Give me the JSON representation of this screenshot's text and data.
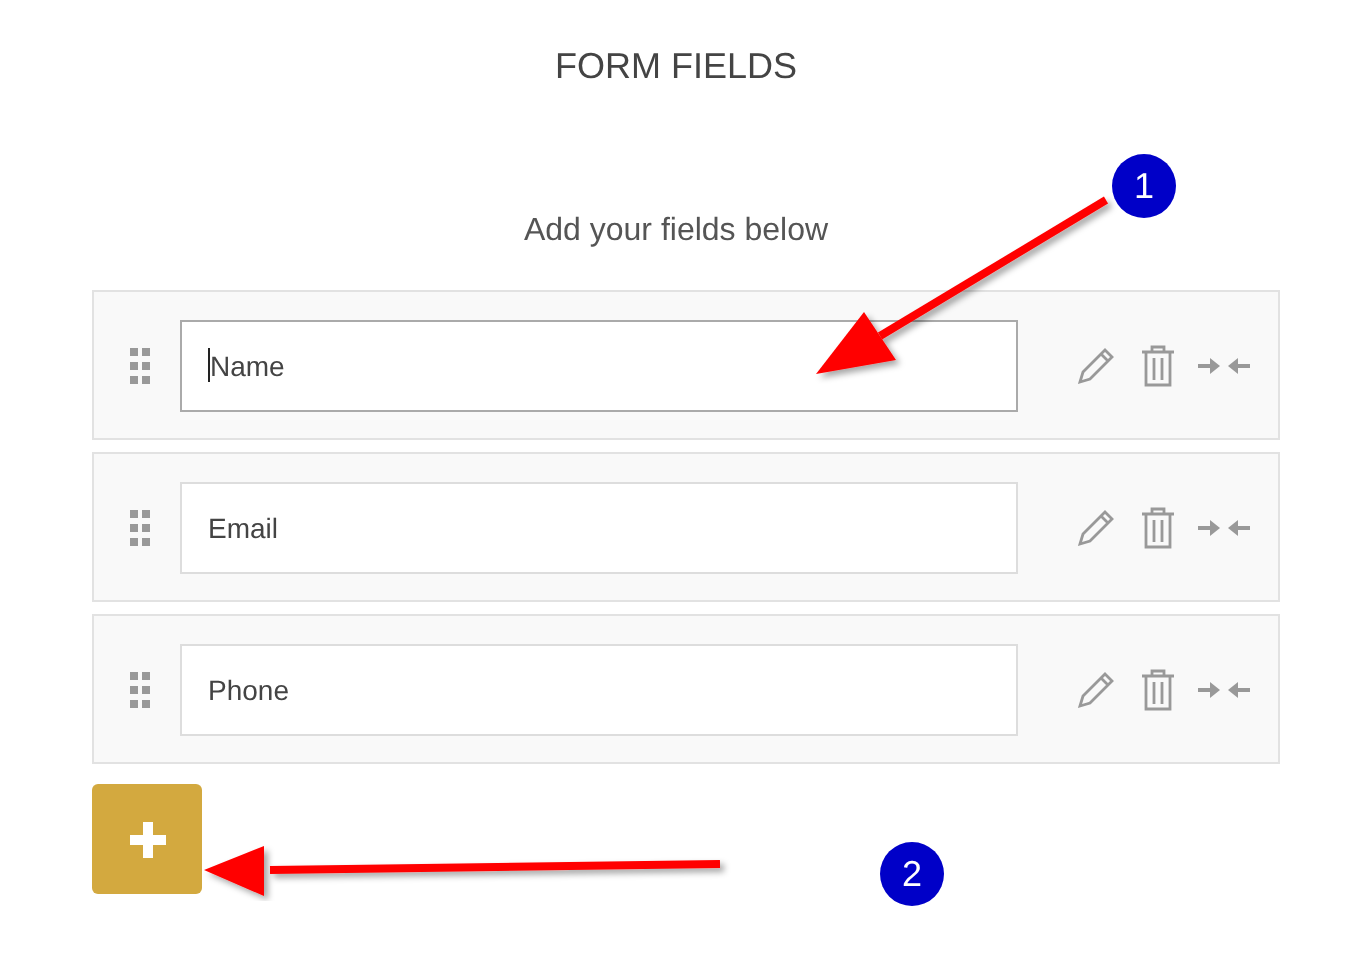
{
  "title": "FORM FIELDS",
  "subtitle": "Add your fields below",
  "fields": [
    {
      "value": "Name",
      "focused": true
    },
    {
      "value": "Email",
      "focused": false
    },
    {
      "value": "Phone",
      "focused": false
    }
  ],
  "callouts": [
    {
      "number": "1"
    },
    {
      "number": "2"
    }
  ]
}
